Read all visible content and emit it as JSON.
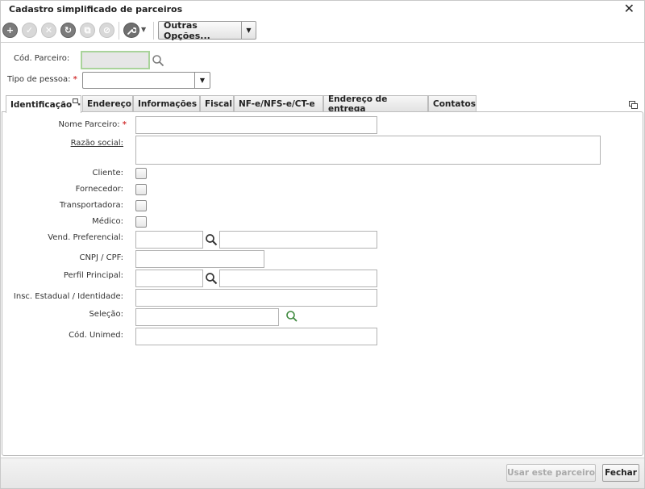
{
  "window": {
    "title": "Cadastro simplificado de parceiros"
  },
  "toolbar": {
    "buttons": [
      {
        "icon": "add-icon",
        "glyph": "+",
        "state": "active"
      },
      {
        "icon": "confirm-icon",
        "glyph": "✓",
        "state": "disabled"
      },
      {
        "icon": "cancel-icon",
        "glyph": "✕",
        "state": "disabled"
      },
      {
        "icon": "refresh-icon",
        "glyph": "↻",
        "state": "active"
      },
      {
        "icon": "copy-icon",
        "glyph": "⧉",
        "state": "disabled"
      },
      {
        "icon": "attach-icon",
        "glyph": "⊘",
        "state": "disabled"
      }
    ],
    "tools_icon": "wrench-icon",
    "more_options_label": "Outras Opções..."
  },
  "header_fields": {
    "cod_parceiro_label": "Cód. Parceiro:",
    "tipo_pessoa_label": "Tipo de pessoa:",
    "required_marker": "*"
  },
  "tabs": [
    {
      "label": "Identificação",
      "active": true
    },
    {
      "label": "Endereço",
      "active": false
    },
    {
      "label": "Informações",
      "active": false
    },
    {
      "label": "Fiscal",
      "active": false
    },
    {
      "label": "NF-e/NFS-e/CT-e",
      "active": false
    },
    {
      "label": "Endereço de entrega",
      "active": false
    },
    {
      "label": "Contatos",
      "active": false
    }
  ],
  "form": {
    "nome_parceiro": "Nome Parceiro:",
    "razao_social": "Razão social:",
    "cliente": "Cliente:",
    "fornecedor": "Fornecedor:",
    "transportadora": "Transportadora:",
    "medico": "Médico:",
    "vend_preferencial": "Vend. Preferencial:",
    "cnpj_cpf": "CNPJ / CPF:",
    "perfil_principal": "Perfil Principal:",
    "insc_estadual": "Insc. Estadual / Identidade:",
    "selecao": "Seleção:",
    "cod_unimed": "Cód. Unimed:"
  },
  "footer": {
    "use_partner_label": "Usar este parceiro",
    "close_label": "Fechar"
  },
  "colors": {
    "required": "#d43b3b",
    "focus_border": "#a9d39a",
    "search_green": "#3f8a3f"
  }
}
